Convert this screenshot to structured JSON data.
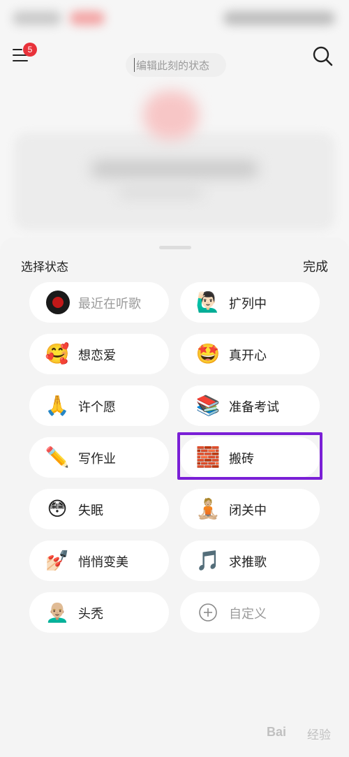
{
  "header": {
    "menu_badge": "5",
    "status_placeholder": "编辑此刻的状态"
  },
  "sheet": {
    "title": "选择状态",
    "done_label": "完成",
    "items": [
      {
        "label": "最近在听歌",
        "icon": "record-icon",
        "emoji": ""
      },
      {
        "label": "扩列中",
        "icon": "person-raising-hand-icon",
        "emoji": "🙋🏻‍♂️"
      },
      {
        "label": "想恋爱",
        "icon": "smiling-face-with-hearts-icon",
        "emoji": "🥰"
      },
      {
        "label": "真开心",
        "icon": "star-struck-icon",
        "emoji": "🤩"
      },
      {
        "label": "许个愿",
        "icon": "folded-hands-icon",
        "emoji": "🙏"
      },
      {
        "label": "准备考试",
        "icon": "books-icon",
        "emoji": "📚"
      },
      {
        "label": "写作业",
        "icon": "pencil-icon",
        "emoji": "✏️"
      },
      {
        "label": "搬砖",
        "icon": "brick-icon",
        "emoji": "🧱"
      },
      {
        "label": "失眠",
        "icon": "flushed-face-icon",
        "emoji": "😳"
      },
      {
        "label": "闭关中",
        "icon": "person-lotus-position-icon",
        "emoji": "🧘🏼"
      },
      {
        "label": "悄悄变美",
        "icon": "nail-polish-icon",
        "emoji": "💅🏻"
      },
      {
        "label": "求推歌",
        "icon": "musical-note-icon",
        "emoji": "🎵"
      },
      {
        "label": "头秃",
        "icon": "bald-man-icon",
        "emoji": "👨🏼‍🦲"
      },
      {
        "label": "自定义",
        "icon": "plus-circle-icon",
        "emoji": ""
      }
    ]
  },
  "colors": {
    "badge": "#e8323a",
    "highlight": "#7a1fd6"
  },
  "watermark": {
    "brand": "Bai",
    "suffix": "经验"
  }
}
